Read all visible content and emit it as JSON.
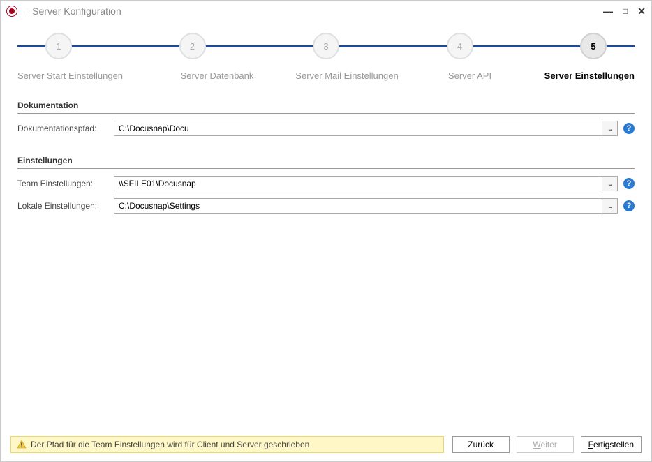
{
  "window": {
    "title": "Server Konfiguration"
  },
  "stepper": {
    "steps": [
      {
        "num": "1",
        "label": "Server Start Einstellungen"
      },
      {
        "num": "2",
        "label": "Server Datenbank"
      },
      {
        "num": "3",
        "label": "Server Mail Einstellungen"
      },
      {
        "num": "4",
        "label": "Server API"
      },
      {
        "num": "5",
        "label": "Server Einstellungen"
      }
    ],
    "active_index": 4
  },
  "sections": {
    "doc": {
      "title": "Dokumentation",
      "path_label": "Dokumentationspfad:",
      "path_value": "C:\\Docusnap\\Docu"
    },
    "settings": {
      "title": "Einstellungen",
      "team_label": "Team Einstellungen:",
      "team_value": "\\\\SFILE01\\Docusnap",
      "local_label": "Lokale Einstellungen:",
      "local_value": "C:\\Docusnap\\Settings"
    }
  },
  "status": {
    "message": "Der Pfad für die Team Einstellungen wird für Client und Server geschrieben"
  },
  "buttons": {
    "back": "Zurück",
    "next_prefix": "W",
    "next_rest": "eiter",
    "finish_prefix": "F",
    "finish_rest": "ertigstellen"
  }
}
